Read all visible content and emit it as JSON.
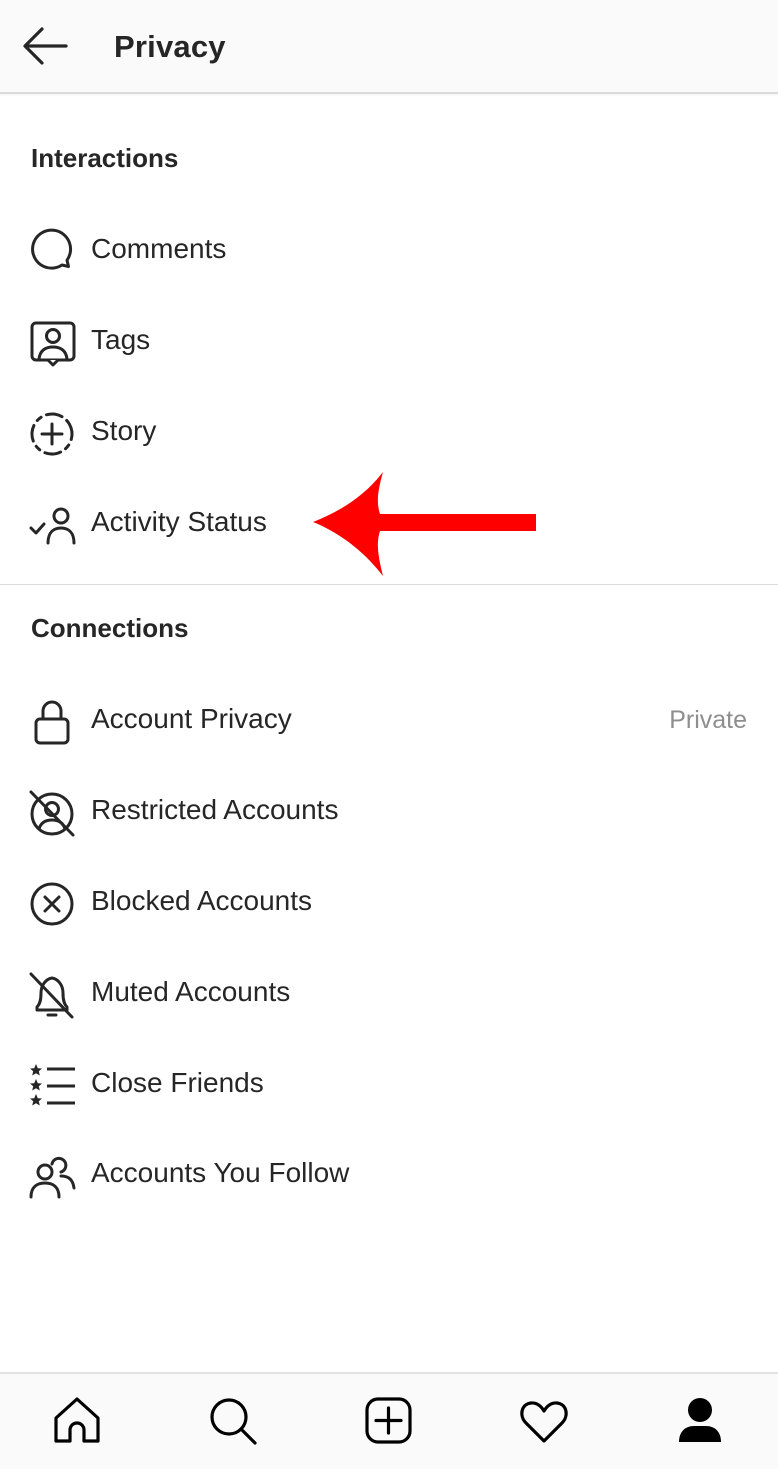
{
  "header": {
    "title": "Privacy",
    "back_icon": "arrow-left-icon"
  },
  "sections": [
    {
      "title": "Interactions",
      "items": [
        {
          "label": "Comments",
          "icon": "comment-bubble-icon"
        },
        {
          "label": "Tags",
          "icon": "tag-person-icon"
        },
        {
          "label": "Story",
          "icon": "story-add-icon"
        },
        {
          "label": "Activity Status",
          "icon": "activity-status-icon"
        }
      ]
    },
    {
      "title": "Connections",
      "items": [
        {
          "label": "Account Privacy",
          "icon": "lock-icon",
          "value": "Private"
        },
        {
          "label": "Restricted Accounts",
          "icon": "restricted-icon"
        },
        {
          "label": "Blocked Accounts",
          "icon": "blocked-icon"
        },
        {
          "label": "Muted Accounts",
          "icon": "muted-bell-icon"
        },
        {
          "label": "Close Friends",
          "icon": "close-friends-list-icon"
        },
        {
          "label": "Accounts You Follow",
          "icon": "people-icon"
        }
      ]
    }
  ],
  "annotation": {
    "type": "arrow",
    "target": "Activity Status",
    "color": "#ff0000"
  },
  "bottom_nav": [
    {
      "name": "home",
      "icon": "home-icon"
    },
    {
      "name": "search",
      "icon": "search-icon"
    },
    {
      "name": "new-post",
      "icon": "add-post-icon"
    },
    {
      "name": "activity",
      "icon": "heart-icon"
    },
    {
      "name": "profile",
      "icon": "profile-icon",
      "active": true
    }
  ]
}
